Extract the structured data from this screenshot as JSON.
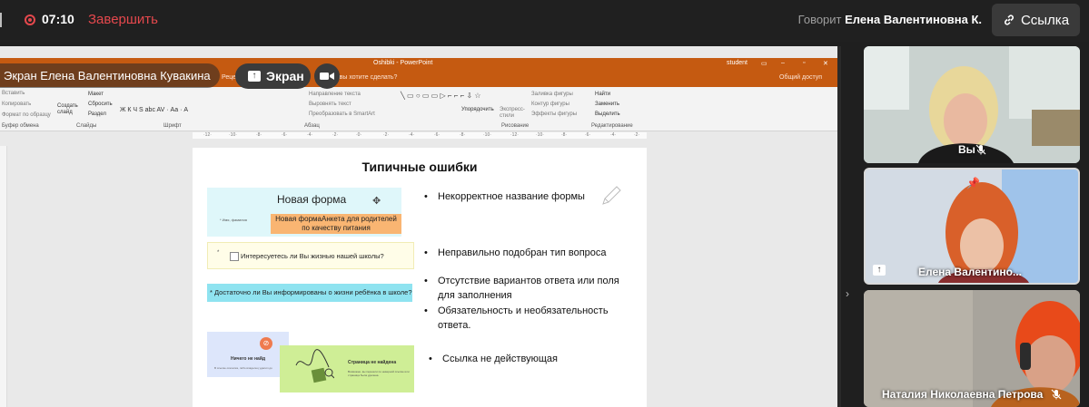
{
  "topbar": {
    "timer": "07:10",
    "finish_label": "Завершить",
    "speaker_prefix": "Говорит",
    "speaker_name": "Елена Валентиновна К.",
    "link_label": "Ссылка"
  },
  "overlay": {
    "presenter_name": "Экран Елена Валентиновна Кувакина",
    "screen_label": "Экран"
  },
  "powerpoint": {
    "file_title": "Oshibki - PowerPoint",
    "user": "student",
    "search_hint": "Что вы хотите сделать?",
    "share_label": "Общий доступ",
    "tab_fragment": "Рецензир",
    "ribbon": {
      "layout": "Макет",
      "reset": "Сбросить",
      "section": "Раздел",
      "new_slide": "Создать слайд",
      "clipboard_group": "Буфер обмена",
      "slides_group": "Слайды",
      "font_group": "Шрифт",
      "paragraph_group": "Абзац",
      "drawing_group": "Рисование",
      "editing_group": "Редактирование",
      "text_direction": "Направление текста",
      "align_text": "Выровнять текст",
      "smartart": "Преобразовать в SmartArt",
      "arrange": "Упорядочить",
      "quick_styles": "Экспресс-стили",
      "fill": "Заливка фигуры",
      "outline": "Контур фигуры",
      "effects": "Эффекты фигуры",
      "find": "Найти",
      "replace": "Заменить",
      "select": "Выделить",
      "paste_fragment": "Вставить",
      "copy_fragment": "Копировать",
      "format_fragment": "Формат по образцу"
    }
  },
  "slide": {
    "title": "Типичные ошибки",
    "img1_title": "Новая форма",
    "img1_field": "* Имя, фамилия",
    "img1_orange": "Новая формаАнкета для родителей по качеству питания",
    "img2_text": "Интересуетесь ли Вы жизнью нашей школы?",
    "img3_text": "* Достаточно ли Вы информированы о жизни ребёнка в школе?",
    "img4_title": "Ничего не найд",
    "img4_sub": "В ссылке опечатка, либо владелец удалил до",
    "img5_title": "Страница не найдена",
    "img5_sub": "Возможно, вы перешли по неверной ссылке или страница была удалена.",
    "bullets": [
      "Некорректное название формы",
      "Неправильно подобран тип вопроса",
      "Отсутствие вариантов ответа или поля для заполнения",
      "Обязательность и необязательность ответа.",
      "Ссылка не действующая"
    ]
  },
  "participants": [
    {
      "name": "Вы",
      "mic_muted": true
    },
    {
      "name": "Елена Валентино...",
      "pinned": true,
      "sharing": true
    },
    {
      "name": "Наталия Николаевна Петрова",
      "mic_muted": true
    }
  ],
  "colors": {
    "accent_red": "#e5484d",
    "powerpoint_orange": "#c55a11",
    "background": "#1f1f1f"
  }
}
